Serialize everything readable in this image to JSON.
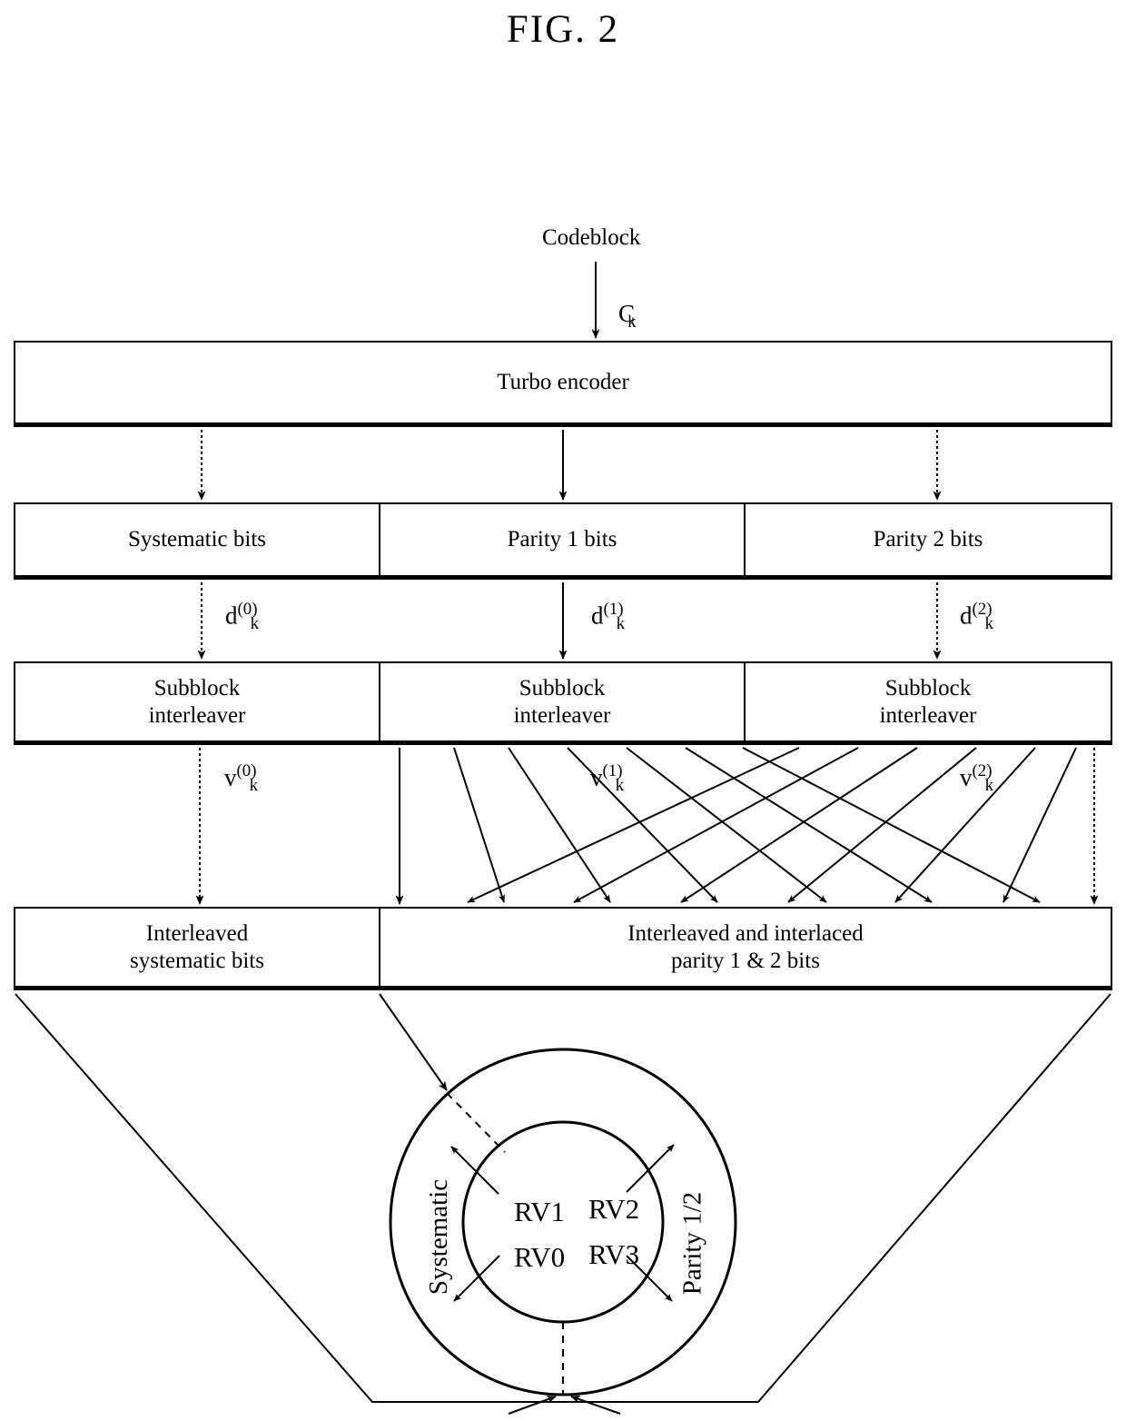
{
  "figure": {
    "title": "FIG. 2",
    "domain_note": "patent block diagram of turbo encoder rate matching"
  },
  "top": {
    "source_label": "Codeblock",
    "input_symbol_base": "C",
    "input_symbol_sub": "k"
  },
  "encoder": {
    "label": "Turbo encoder"
  },
  "bits_row": {
    "cells": [
      {
        "label": "Systematic bits"
      },
      {
        "label": "Parity 1 bits"
      },
      {
        "label": "Parity 2 bits"
      }
    ]
  },
  "d_signals": [
    {
      "base": "d",
      "sup": "(0)",
      "sub": "k"
    },
    {
      "base": "d",
      "sup": "(1)",
      "sub": "k"
    },
    {
      "base": "d",
      "sup": "(2)",
      "sub": "k"
    }
  ],
  "interleaver_row": {
    "cells": [
      {
        "line1": "Subblock",
        "line2": "interleaver"
      },
      {
        "line1": "Subblock",
        "line2": "interleaver"
      },
      {
        "line1": "Subblock",
        "line2": "interleaver"
      }
    ]
  },
  "v_signals": [
    {
      "base": "v",
      "sup": "(0)",
      "sub": "k"
    },
    {
      "base": "v",
      "sup": "(1)",
      "sub": "k"
    },
    {
      "base": "v",
      "sup": "(2)",
      "sub": "k"
    }
  ],
  "output_row": {
    "cells": [
      {
        "line1": "Interleaved",
        "line2": "systematic bits"
      },
      {
        "line1": "Interleaved and interlaced",
        "line2": "parity 1 & 2 bits"
      }
    ]
  },
  "circular_buffer": {
    "outer_left_label": "Systematic",
    "outer_right_label": "Parity 1/2",
    "redundancy_versions": [
      {
        "id": "RV1",
        "quadrant": "top-left"
      },
      {
        "id": "RV2",
        "quadrant": "top-right"
      },
      {
        "id": "RV0",
        "quadrant": "bottom-left"
      },
      {
        "id": "RV3",
        "quadrant": "bottom-right"
      }
    ]
  },
  "colors": {
    "stroke": "#000000",
    "background": "#ffffff"
  }
}
